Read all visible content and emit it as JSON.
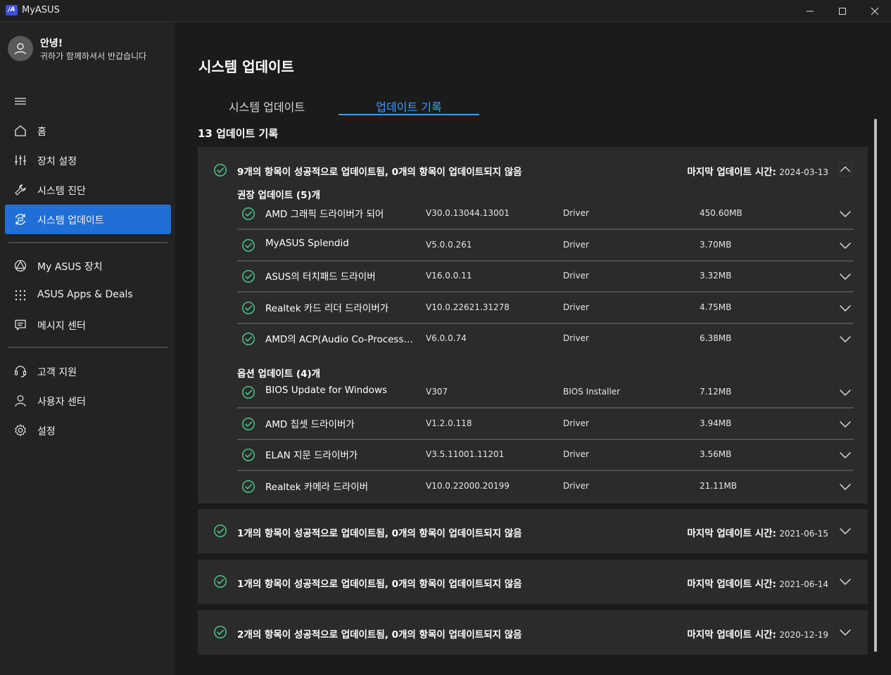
{
  "window": {
    "title": "MyASUS",
    "logo_text": "/A"
  },
  "sidebar": {
    "greeting": "안녕!",
    "greeting_sub": "귀하가 함께하셔서 반갑습니다",
    "items": [
      {
        "label": "홈",
        "icon": "home-icon"
      },
      {
        "label": "장치 설정",
        "icon": "sliders-icon"
      },
      {
        "label": "시스템 진단",
        "icon": "wrench-icon"
      },
      {
        "label": "시스템 업데이트",
        "icon": "update-icon",
        "active": true
      },
      {
        "label": "My ASUS 장치",
        "icon": "devices-icon"
      },
      {
        "label": "ASUS Apps & Deals",
        "icon": "grid-dots-icon"
      },
      {
        "label": "메시지 센터",
        "icon": "message-icon"
      },
      {
        "label": "고객 지원",
        "icon": "headset-icon"
      },
      {
        "label": "사용자 센터",
        "icon": "user-icon"
      },
      {
        "label": "설정",
        "icon": "gear-icon"
      }
    ]
  },
  "main": {
    "title": "시스템 업데이트",
    "tabs": [
      {
        "label": "시스템 업데이트",
        "active": false
      },
      {
        "label": "업데이트 기록",
        "active": true
      }
    ],
    "history_count_label": "13 업데이트 기록",
    "last_update_label": "마지막 업데이트 시간:",
    "records": [
      {
        "summary": "9개의 항목이 성공적으로 업데이트됨, 0개의 항목이 업데이트되지 않음",
        "date": "2024-03-13",
        "expanded": true,
        "groups": [
          {
            "title": "권장 업데이트 (5)개",
            "items": [
              {
                "name": "AMD 그래픽 드라이버가 되어",
                "version": "V30.0.13044.13001",
                "type": "Driver",
                "size": "450.60MB"
              },
              {
                "name": "MyASUS Splendid",
                "version": "V5.0.0.261",
                "type": "Driver",
                "size": "3.70MB"
              },
              {
                "name": "ASUS의 터치패드 드라이버",
                "version": "V16.0.0.11",
                "type": "Driver",
                "size": "3.32MB"
              },
              {
                "name": "Realtek 카드 리더 드라이버가",
                "version": "V10.0.22621.31278",
                "type": "Driver",
                "size": "4.75MB"
              },
              {
                "name": "AMD의 ACP(Audio Co-Processor)...",
                "version": "V6.0.0.74",
                "type": "Driver",
                "size": "6.38MB"
              }
            ]
          },
          {
            "title": "옵션 업데이트 (4)개",
            "items": [
              {
                "name": "BIOS Update for Windows",
                "version": "V307",
                "type": "BIOS Installer",
                "size": "7.12MB"
              },
              {
                "name": "AMD 칩셋 드라이버가",
                "version": "V1.2.0.118",
                "type": "Driver",
                "size": "3.94MB"
              },
              {
                "name": "ELAN 지문 드라이버가",
                "version": "V3.5.11001.11201",
                "type": "Driver",
                "size": "3.56MB"
              },
              {
                "name": "Realtek 카메라 드라이버",
                "version": "V10.0.22000.20199",
                "type": "Driver",
                "size": "21.11MB"
              }
            ]
          }
        ]
      },
      {
        "summary": "1개의 항목이 성공적으로 업데이트됨, 0개의 항목이 업데이트되지 않음",
        "date": "2021-06-15",
        "expanded": false
      },
      {
        "summary": "1개의 항목이 성공적으로 업데이트됨, 0개의 항목이 업데이트되지 않음",
        "date": "2021-06-14",
        "expanded": false
      },
      {
        "summary": "2개의 항목이 성공적으로 업데이트됨, 0개의 항목이 업데이트되지 않음",
        "date": "2020-12-19",
        "expanded": false
      }
    ]
  },
  "colors": {
    "accent": "#1f6fd6",
    "tab_active": "#3d9bff",
    "success": "#4cc38a",
    "card": "#2b2b2b",
    "sidebar": "#232323"
  }
}
